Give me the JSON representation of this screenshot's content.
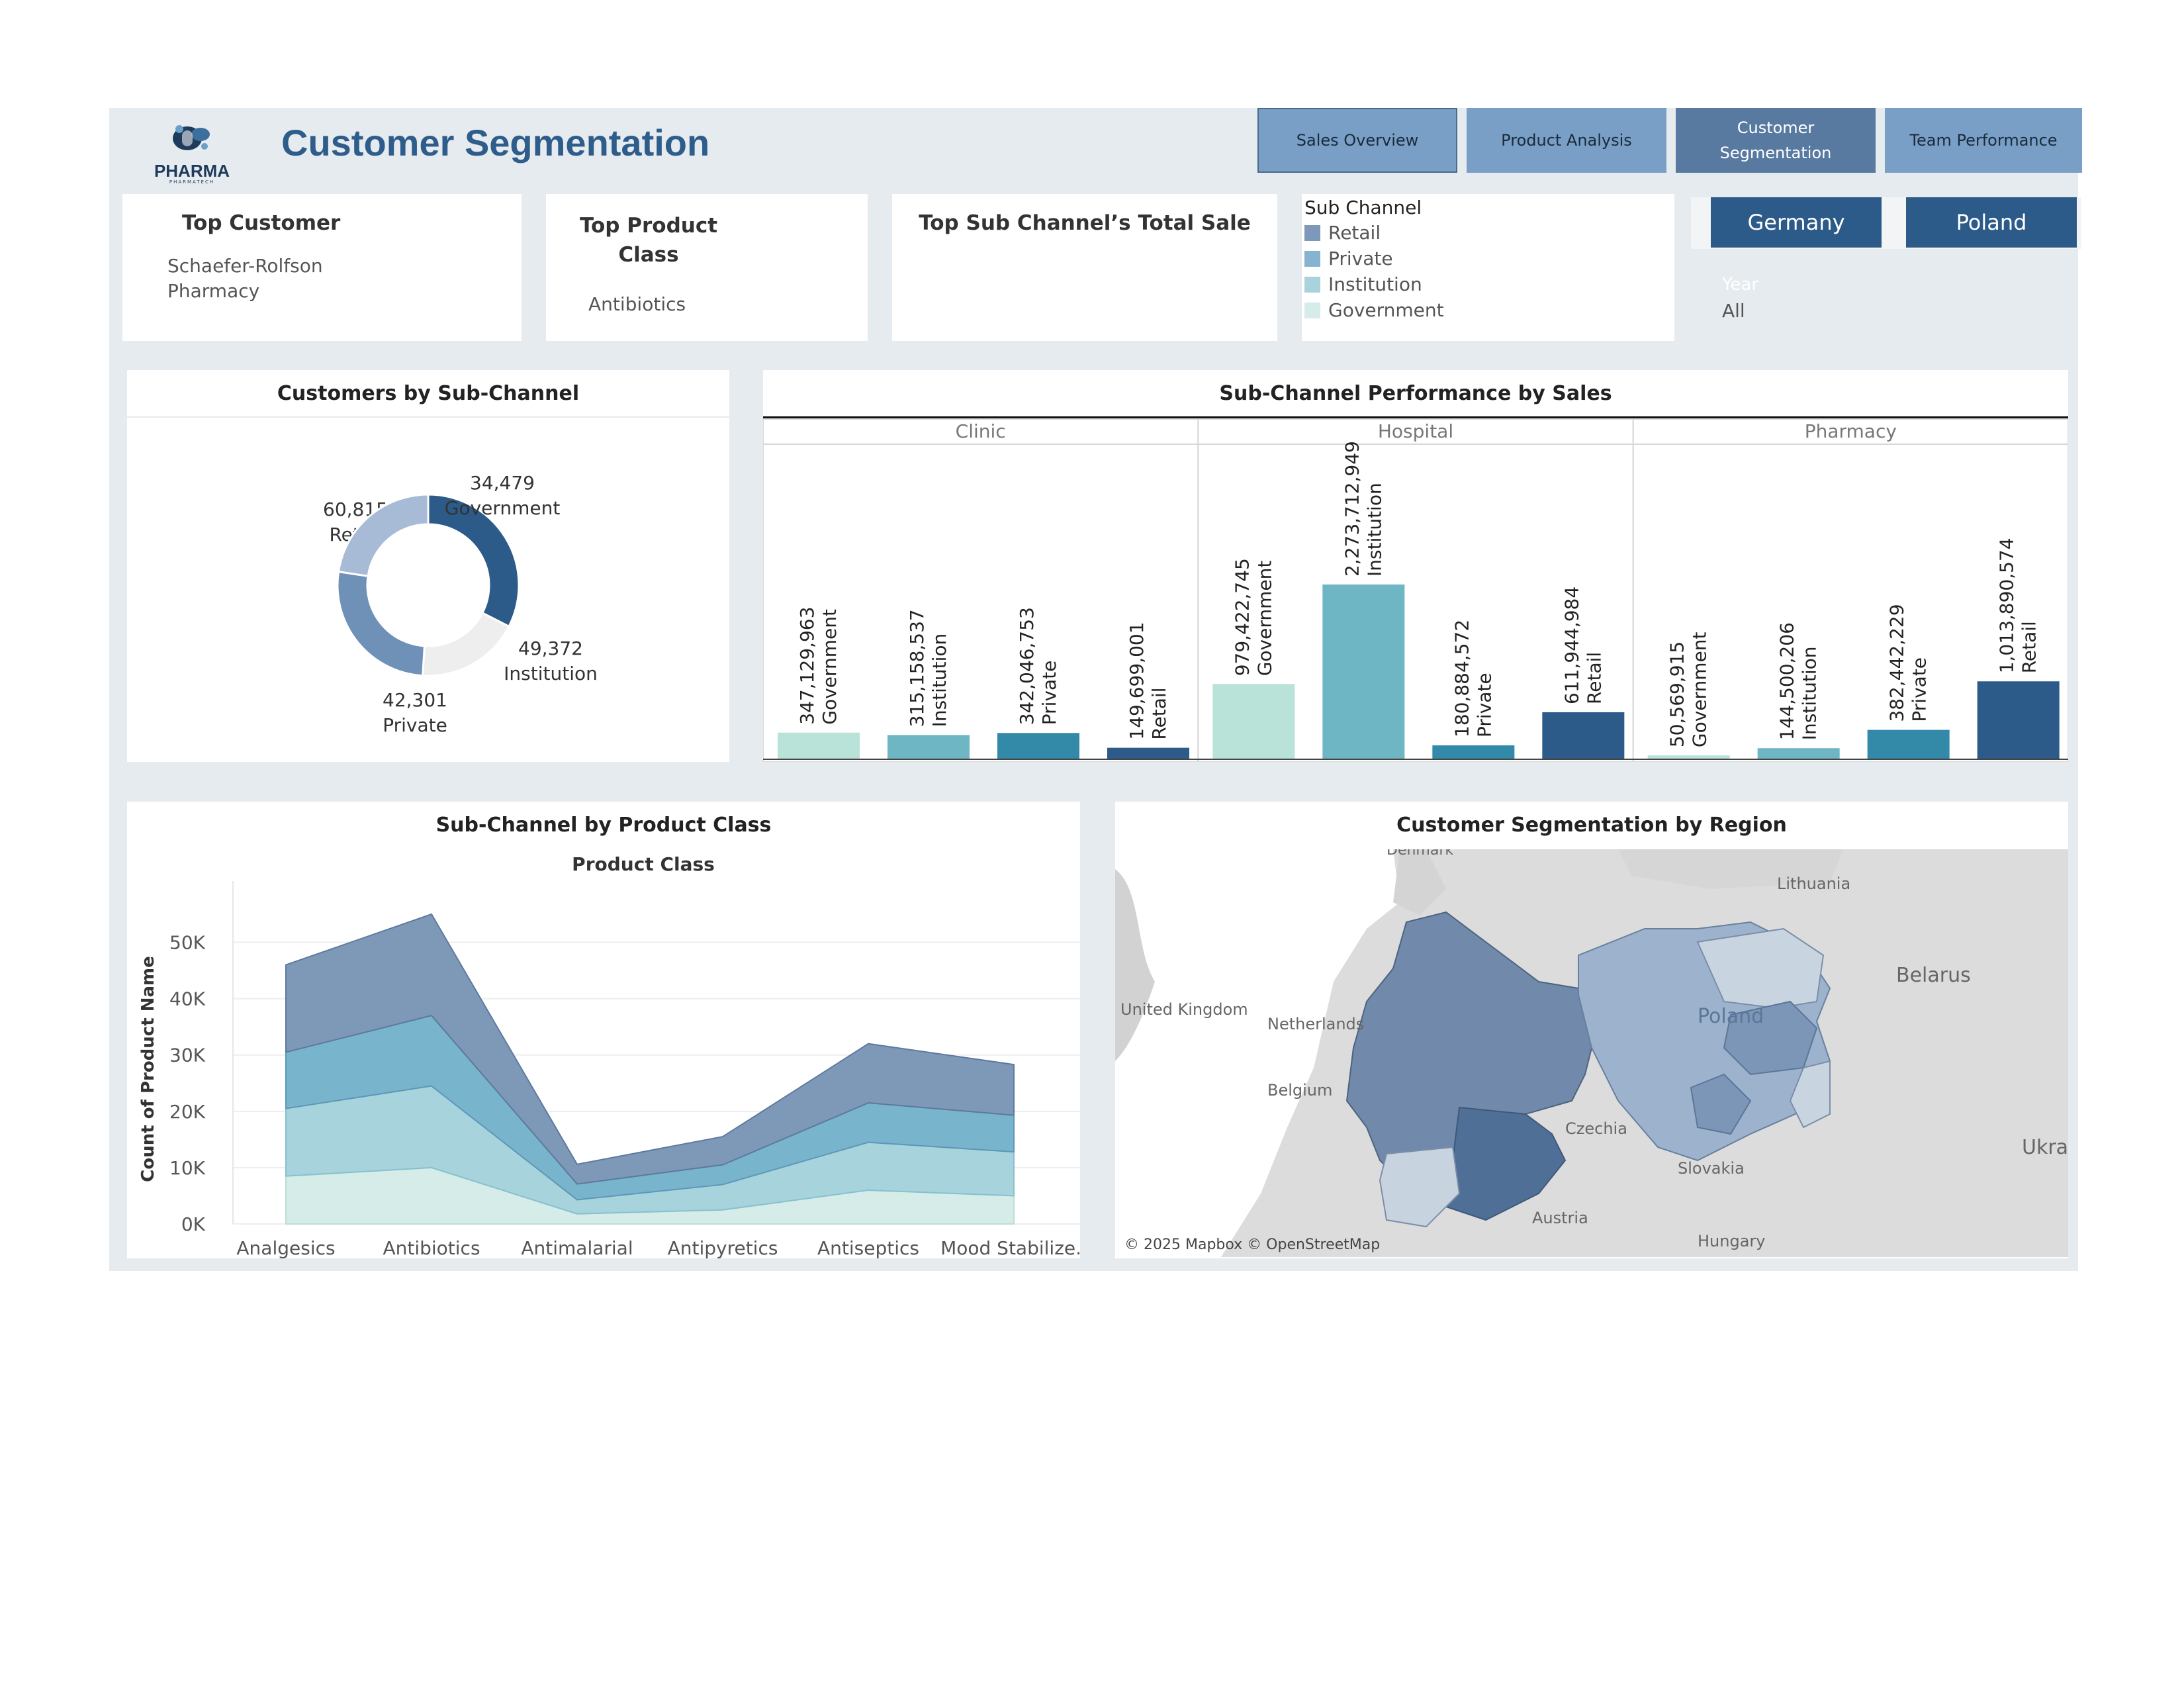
{
  "header": {
    "title": "Customer Segmentation",
    "logo_text": "PHARMA",
    "logo_subtext": "PHARMATECH"
  },
  "nav": {
    "items": [
      {
        "label": "Sales Overview",
        "active": false
      },
      {
        "label": "Product Analysis",
        "active": false
      },
      {
        "label": "Customer Segmentation",
        "active": true
      },
      {
        "label": "Team Performance",
        "active": false
      }
    ]
  },
  "kpis": {
    "top_customer": {
      "label": "Top Customer",
      "value": "Schaefer-Rolfson Pharmacy"
    },
    "top_product_class": {
      "label": "Top Product Class",
      "value": "Antibiotics"
    },
    "top_sub_channel": {
      "label": "Top Sub Channel’s Total Sale",
      "value": ""
    }
  },
  "legend": {
    "title": "Sub Channel",
    "items": [
      {
        "label": "Retail",
        "color": "#7d98b8"
      },
      {
        "label": "Private",
        "color": "#86b3cf"
      },
      {
        "label": "Institution",
        "color": "#a9d2dc"
      },
      {
        "label": "Government",
        "color": "#d5ece8"
      }
    ]
  },
  "filters": {
    "countries": [
      "Germany",
      "Poland"
    ],
    "year_label": "Year",
    "year_value": "All"
  },
  "colors": {
    "accent": "#2e5d8c",
    "dashboard_bg": "#e6ebef",
    "retail": "#2c5a89",
    "private": "#3289a8",
    "institution": "#6eb6c4",
    "government": "#b9e2d9"
  },
  "donut": {
    "title": "Customers by Sub-Channel",
    "chart_data": {
      "type": "pie",
      "slices": [
        {
          "name": "Retail",
          "value": 60815
        },
        {
          "name": "Government",
          "value": 34479
        },
        {
          "name": "Institution",
          "value": 49372
        },
        {
          "name": "Private",
          "value": 42301
        }
      ],
      "labels": [
        "60,815",
        "34,479",
        "49,372",
        "42,301"
      ]
    }
  },
  "bars": {
    "title": "Sub-Channel Performance by Sales",
    "chart_data": {
      "type": "bar",
      "panels": [
        {
          "name": "Clinic",
          "bars": [
            {
              "sub": "Government",
              "value": 347129963,
              "label": "347,129,963"
            },
            {
              "sub": "Institution",
              "value": 315158537,
              "label": "315,158,537"
            },
            {
              "sub": "Private",
              "value": 342046753,
              "label": "342,046,753"
            },
            {
              "sub": "Retail",
              "value": 149699001,
              "label": "149,699,001"
            }
          ]
        },
        {
          "name": "Hospital",
          "bars": [
            {
              "sub": "Government",
              "value": 979422745,
              "label": "979,422,745"
            },
            {
              "sub": "Institution",
              "value": 2273712949,
              "label": "2,273,712,949"
            },
            {
              "sub": "Private",
              "value": 180884572,
              "label": "180,884,572"
            },
            {
              "sub": "Retail",
              "value": 611944984,
              "label": "611,944,984"
            }
          ]
        },
        {
          "name": "Pharmacy",
          "bars": [
            {
              "sub": "Government",
              "value": 50569915,
              "label": "50,569,915"
            },
            {
              "sub": "Institution",
              "value": 144500206,
              "label": "144,500,206"
            },
            {
              "sub": "Private",
              "value": 382442229,
              "label": "382,442,229"
            },
            {
              "sub": "Retail",
              "value": 1013890574,
              "label": "1,013,890,574"
            }
          ]
        }
      ]
    }
  },
  "area": {
    "title": "Sub-Channel by Product Class",
    "chart_data": {
      "type": "area",
      "stacked": true,
      "x_title": "Product Class",
      "ylabel": "Count of Product Name",
      "categories": [
        "Analgesics",
        "Antibiotics",
        "Antimalarial",
        "Antipyretics",
        "Antiseptics",
        "Mood Stabilize.."
      ],
      "ylim": [
        0,
        55000
      ],
      "yticks": [
        "0K",
        "10K",
        "20K",
        "30K",
        "40K",
        "50K"
      ],
      "ytick_values": [
        0,
        10000,
        20000,
        30000,
        40000,
        50000
      ],
      "series": [
        {
          "name": "Government",
          "values": [
            8500,
            10000,
            1800,
            2500,
            6000,
            5000
          ]
        },
        {
          "name": "Institution",
          "values": [
            12000,
            14500,
            2500,
            4500,
            8500,
            7800
          ]
        },
        {
          "name": "Private",
          "values": [
            10000,
            12500,
            2800,
            3500,
            7000,
            6500
          ]
        },
        {
          "name": "Retail",
          "values": [
            15500,
            18000,
            3500,
            5000,
            10500,
            9000
          ]
        }
      ]
    }
  },
  "map": {
    "title": "Customer Segmentation by Region",
    "attribution": "© 2025 Mapbox © OpenStreetMap",
    "labels": [
      "Denmark",
      "Lithuania",
      "Belarus",
      "United Kingdom",
      "Netherlands",
      "Belgium",
      "Poland",
      "Czechia",
      "Slovakia",
      "Ukrai",
      "Austria",
      "Hungary"
    ]
  }
}
